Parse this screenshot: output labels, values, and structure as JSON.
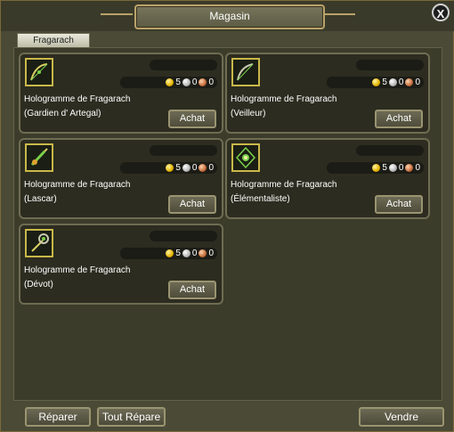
{
  "window": {
    "title": "Magasin",
    "close_label": "X"
  },
  "tab": {
    "label": "Fragarach"
  },
  "items": [
    {
      "name_line1": "Hologramme de Fragarach",
      "name_line2": "(Gardien d' Artegal)",
      "gold": "5",
      "silver": "0",
      "copper": "0",
      "buy_label": "Achat",
      "icon": "bow-icon"
    },
    {
      "name_line1": "Hologramme de Fragarach",
      "name_line2": "(Veilleur)",
      "gold": "5",
      "silver": "0",
      "copper": "0",
      "buy_label": "Achat",
      "icon": "bow-icon"
    },
    {
      "name_line1": "Hologramme de Fragarach",
      "name_line2": "(Lascar)",
      "gold": "5",
      "silver": "0",
      "copper": "0",
      "buy_label": "Achat",
      "icon": "dagger-icon"
    },
    {
      "name_line1": "Hologramme de Fragarach",
      "name_line2": "(Élémentaliste)",
      "gold": "5",
      "silver": "0",
      "copper": "0",
      "buy_label": "Achat",
      "icon": "orb-icon"
    },
    {
      "name_line1": "Hologramme de Fragarach",
      "name_line2": "(Dévot)",
      "gold": "5",
      "silver": "0",
      "copper": "0",
      "buy_label": "Achat",
      "icon": "staff-icon"
    }
  ],
  "footer": {
    "repair_label": "Réparer",
    "repair_all_label": "Tout Répare",
    "sell_label": "Vendre"
  },
  "colors": {
    "accent_gold": "#c9b84a",
    "panel": "#2c2c20"
  }
}
